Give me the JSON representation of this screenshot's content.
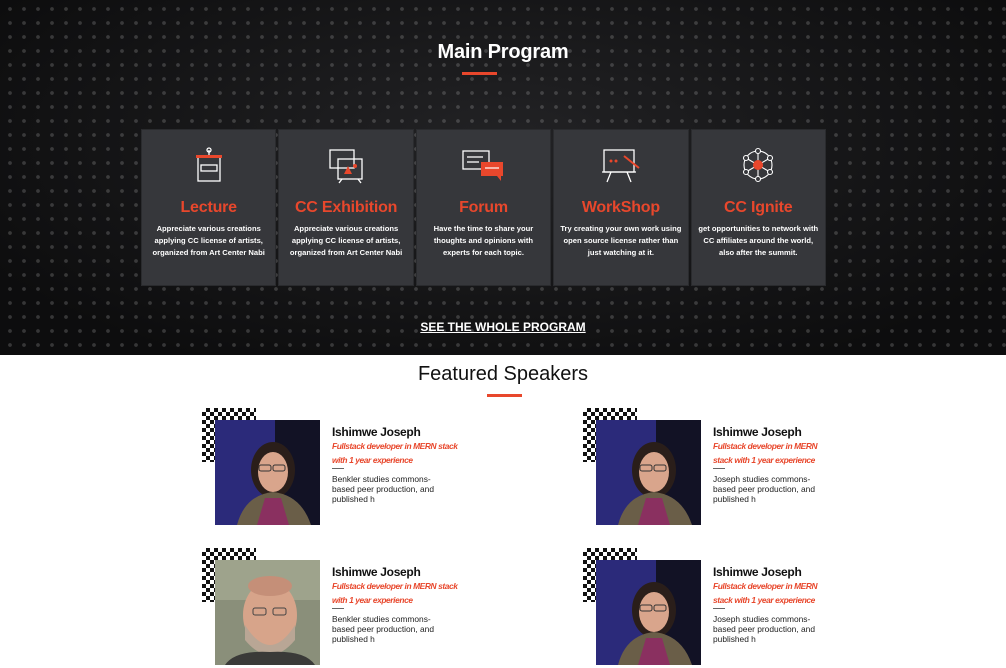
{
  "program": {
    "title": "Main Program",
    "see_all_label": "SEE THE WHOLE PROGRAM",
    "cards": [
      {
        "title": "Lecture",
        "description": "Appreciate various creations applying CC license of artists, organized from Art Center Nabi",
        "icon": "podium-icon"
      },
      {
        "title": "CC Exhibition",
        "description": "Appreciate various creations applying CC license of artists, organized from Art Center Nabi",
        "icon": "gallery-icon"
      },
      {
        "title": "Forum",
        "description": "Have the time to share your thoughts and opinions with experts for each topic.",
        "icon": "chat-bubbles-icon"
      },
      {
        "title": "WorkShop",
        "description": "Try creating your own work using open source license rather than just watching at it.",
        "icon": "whiteboard-icon"
      },
      {
        "title": "CC Ignite",
        "description": "get opportunities to network with CC affiliates around the world, also after the summit.",
        "icon": "network-icon"
      }
    ]
  },
  "speakers": {
    "title": "Featured Speakers",
    "items": [
      {
        "name": "Ishimwe Joseph",
        "role": "Fullstack developer in MERN stack with 1 year experience",
        "bio": "Benkler studies commons-based peer production, and published h",
        "photo": "woman"
      },
      {
        "name": "Ishimwe Joseph",
        "role": "Fullstack developer in MERN stack with 1 year experience",
        "bio": "Joseph studies commons-based peer production, and published h",
        "photo": "woman"
      },
      {
        "name": "Ishimwe Joseph",
        "role": "Fullstack developer in MERN stack with 1 year experience",
        "bio": "Benkler studies commons-based peer production, and published h",
        "photo": "man"
      },
      {
        "name": "Ishimwe Joseph",
        "role": "Fullstack developer in MERN stack with 1 year experience",
        "bio": "Joseph studies commons-based peer production, and published h",
        "photo": "woman"
      }
    ]
  },
  "colors": {
    "accent": "#e8472c",
    "card_bg": "#36373b",
    "dark_bg": "#1c1c1e"
  }
}
